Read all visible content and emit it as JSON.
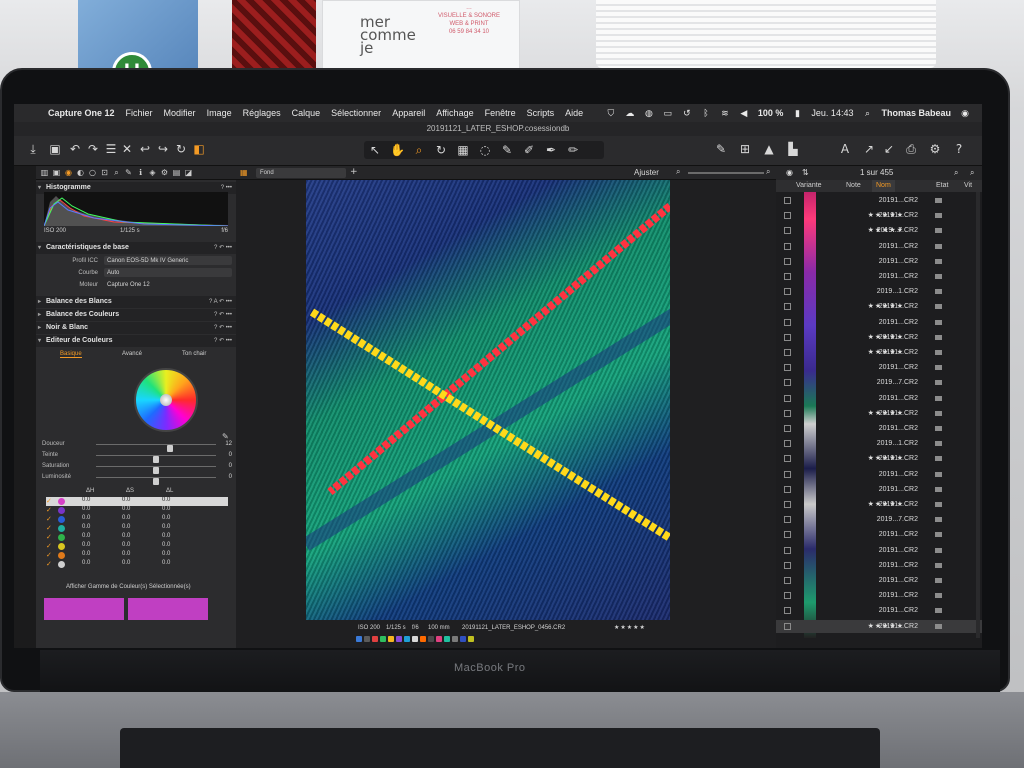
{
  "background": {
    "bottle_logo": "U",
    "card_brand": "mer\ncomme\nje",
    "card_text": "…\nVISUELLE & SONORE\nWEB & PRINT\n06 59 84 34 10",
    "laptop_label": "MacBook Pro"
  },
  "menubar": {
    "app": "Capture One 12",
    "menus": [
      "Fichier",
      "Modifier",
      "Image",
      "Réglages",
      "Calque",
      "Sélectionner",
      "Appareil",
      "Affichage",
      "Fenêtre",
      "Scripts",
      "Aide"
    ],
    "battery": "100 %",
    "clock": "Jeu. 14:43",
    "user": "Thomas Babeau"
  },
  "window": {
    "title": "20191121_LATER_ESHOP.cosessiondb"
  },
  "left_panel": {
    "histogram": {
      "title": "Histogramme",
      "iso": "ISO 200",
      "shutter": "1/125 s",
      "aperture": "f/6"
    },
    "base": {
      "title": "Caractéristiques de base",
      "rows": [
        {
          "key": "Profil ICC",
          "value": "Canon EOS-5D Mk IV Generic"
        },
        {
          "key": "Courbe",
          "value": "Auto"
        },
        {
          "key": "Moteur",
          "value": "Capture One 12"
        }
      ]
    },
    "sections": [
      "Balance des Blancs",
      "Balance des Couleurs",
      "Noir & Blanc",
      "Editeur de Couleurs"
    ],
    "color_editor": {
      "tabs": [
        "Basique",
        "Avancé",
        "Ton chair"
      ],
      "active_tab": "Basique",
      "sliders": [
        {
          "label": "Douceur",
          "value": "12",
          "level": 0.62
        },
        {
          "label": "Teinte",
          "value": "0",
          "level": 0.5
        },
        {
          "label": "Saturation",
          "value": "0",
          "level": 0.5
        },
        {
          "label": "Luminosité",
          "value": "0",
          "level": 0.5
        }
      ],
      "table_headers": [
        "ΔH",
        "ΔS",
        "ΔL"
      ],
      "rows": [
        {
          "color": "#d640c8",
          "dh": "0.0",
          "ds": "0.0",
          "dl": "0.0",
          "selected": true
        },
        {
          "color": "#7a34c8",
          "dh": "0.0",
          "ds": "0.0",
          "dl": "0.0"
        },
        {
          "color": "#2a5dd8",
          "dh": "0.0",
          "ds": "0.0",
          "dl": "0.0"
        },
        {
          "color": "#1fb0a0",
          "dh": "0.0",
          "ds": "0.0",
          "dl": "0.0"
        },
        {
          "color": "#2fb44a",
          "dh": "0.0",
          "ds": "0.0",
          "dl": "0.0"
        },
        {
          "color": "#d9c620",
          "dh": "0.0",
          "ds": "0.0",
          "dl": "0.0"
        },
        {
          "color": "#e07a1a",
          "dh": "0.0",
          "ds": "0.0",
          "dl": "0.0"
        },
        {
          "color": "#cfcfcf",
          "dh": "0.0",
          "ds": "0.0",
          "dl": "0.0"
        }
      ],
      "note": "Afficher Gamme de Couleur(s) Sélectionnée(s)",
      "swatch_color": "#c03fc2"
    }
  },
  "viewer": {
    "preset": "Fond",
    "adjust_label": "Ajuster",
    "meta": {
      "iso": "ISO 200",
      "shutter": "1/125 s",
      "aperture": "f/6",
      "focal": "100 mm",
      "filename": "20191121_LATER_ESHOP_0456.CR2",
      "rating": "★★★★★"
    }
  },
  "browser": {
    "count": "1 sur 455",
    "columns": [
      "Variante",
      "Note",
      "Nom",
      "Etat",
      "Vit"
    ],
    "active_column": "Nom",
    "rows": [
      {
        "stars": "",
        "name": "20191...CR2"
      },
      {
        "stars": "★★★★★",
        "name": "20191...CR2"
      },
      {
        "stars": "★★★★★",
        "name": "2019...7.CR2"
      },
      {
        "stars": "",
        "name": "20191...CR2"
      },
      {
        "stars": "",
        "name": "20191...CR2"
      },
      {
        "stars": "",
        "name": "20191...CR2"
      },
      {
        "stars": "",
        "name": "2019...1.CR2"
      },
      {
        "stars": "★★★★★",
        "name": "20191...CR2"
      },
      {
        "stars": "",
        "name": "20191...CR2"
      },
      {
        "stars": "★★★★★",
        "name": "20191...CR2"
      },
      {
        "stars": "★★★★★",
        "name": "20191...CR2"
      },
      {
        "stars": "",
        "name": "20191...CR2"
      },
      {
        "stars": "",
        "name": "2019...7.CR2"
      },
      {
        "stars": "",
        "name": "20191...CR2"
      },
      {
        "stars": "★★★★★",
        "name": "20191...CR2"
      },
      {
        "stars": "",
        "name": "20191...CR2"
      },
      {
        "stars": "",
        "name": "2019...1.CR2"
      },
      {
        "stars": "★★★★★",
        "name": "20191...CR2"
      },
      {
        "stars": "",
        "name": "20191...CR2"
      },
      {
        "stars": "",
        "name": "20191...CR2"
      },
      {
        "stars": "★★★★★",
        "name": "20191...CR2"
      },
      {
        "stars": "",
        "name": "2019...7.CR2"
      },
      {
        "stars": "",
        "name": "20191...CR2"
      },
      {
        "stars": "",
        "name": "20191...CR2"
      },
      {
        "stars": "",
        "name": "20191...CR2"
      },
      {
        "stars": "",
        "name": "20191...CR2"
      },
      {
        "stars": "",
        "name": "20191...CR2"
      },
      {
        "stars": "",
        "name": "20191...CR2"
      },
      {
        "stars": "★★★★★",
        "name": "20191...CR2",
        "selected": true
      }
    ]
  },
  "colors": {
    "accent": "#f39a25",
    "panel": "#2c2c2e"
  }
}
